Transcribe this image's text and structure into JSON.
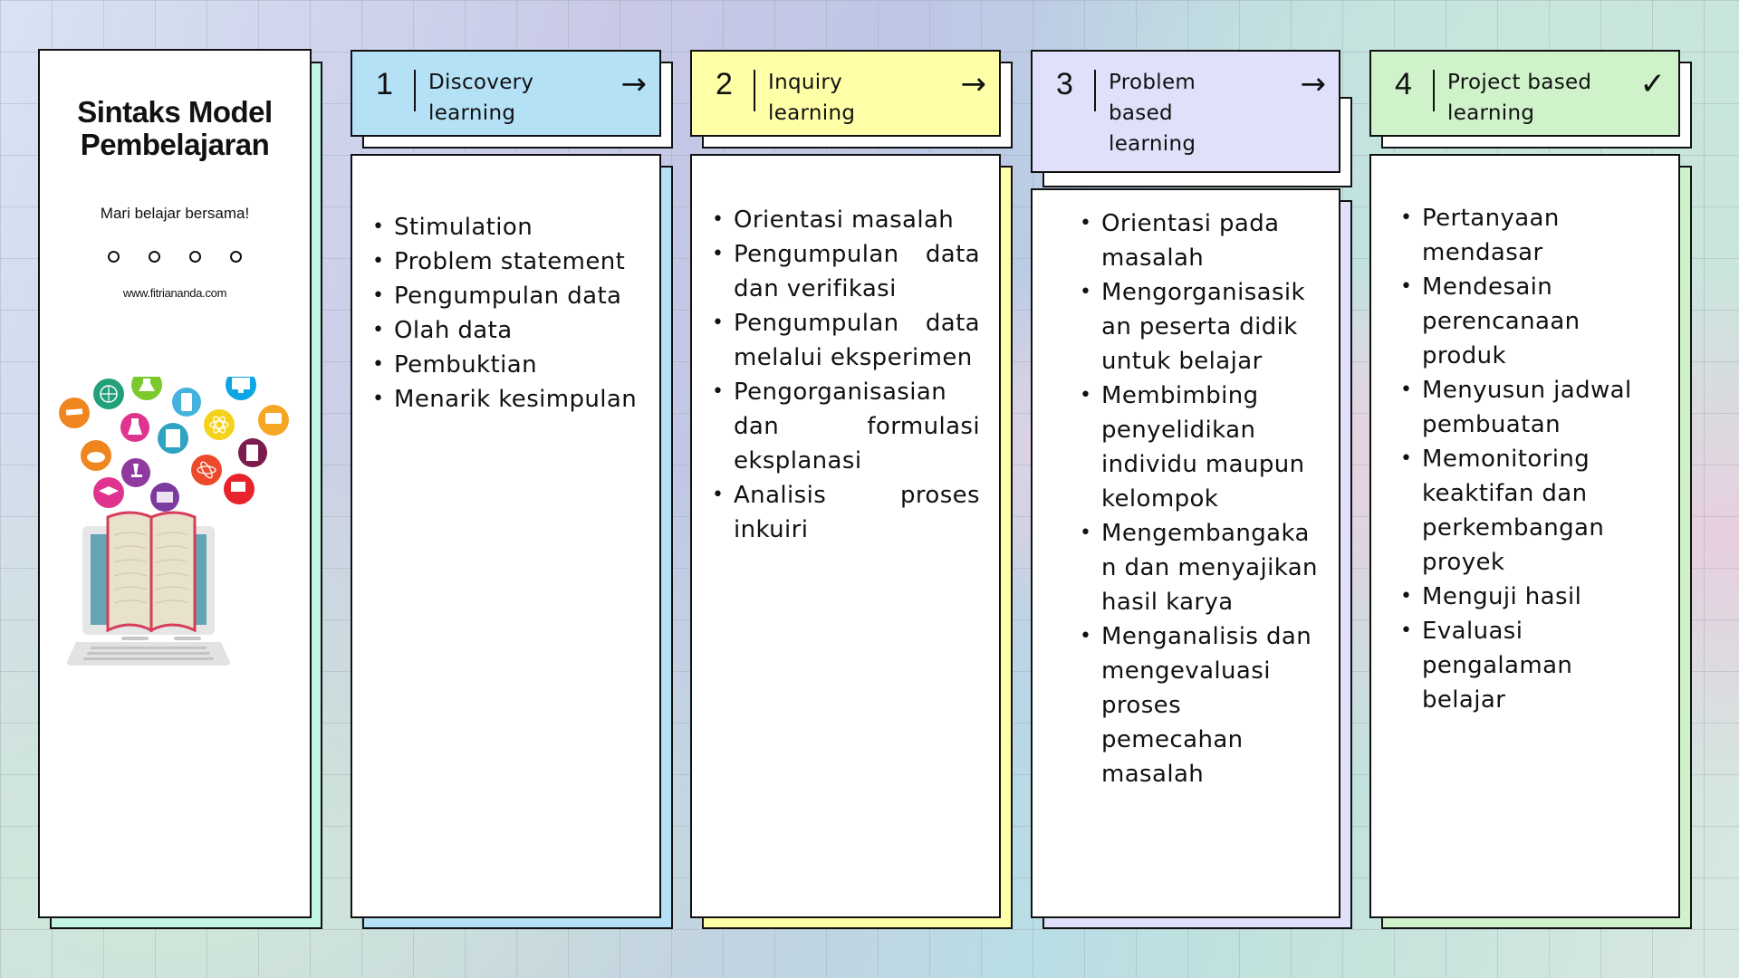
{
  "sidebar": {
    "title_line1": "Sintaks Model",
    "title_line2": "Pembelajaran",
    "subtitle": "Mari belajar bersama!",
    "website": "www.fitriananda.com",
    "dots_count": 4,
    "illustration": "laptop-with-open-book-and-education-icons"
  },
  "colors": {
    "card1": "#b5e1f7",
    "card2": "#ffffa8",
    "card3": "#e0e0fa",
    "card4": "#d0f2ca",
    "sidebar_accent": "#c3f5e3"
  },
  "cards": [
    {
      "number": "1",
      "title": "Discovery learning",
      "title_lines": [
        "Discovery",
        "learning"
      ],
      "icon": "arrow-right-icon",
      "icon_glyph": "→",
      "items": [
        {
          "lines": [
            "Stimulation"
          ]
        },
        {
          "lines": [
            "Problem statement"
          ]
        },
        {
          "lines": [
            "Pengumpulan data"
          ]
        },
        {
          "lines": [
            "Olah data"
          ]
        },
        {
          "lines": [
            "Pembuktian"
          ]
        },
        {
          "lines": [
            "Menarik kesimpulan"
          ]
        }
      ]
    },
    {
      "number": "2",
      "title": "Inquiry learning",
      "title_lines": [
        "Inquiry",
        "learning"
      ],
      "icon": "arrow-right-icon",
      "icon_glyph": "→",
      "items": [
        {
          "lines": [
            "Orientasi masalah"
          ]
        },
        {
          "lines": [
            "Pengumpulan data",
            "dan verifikasi"
          ]
        },
        {
          "lines": [
            "Pengumpulan data",
            "melalui eksperimen"
          ]
        },
        {
          "lines": [
            "Pengorganisasian",
            "dan formulasi",
            "eksplanasi"
          ]
        },
        {
          "lines": [
            "Analisis proses",
            "inkuiri"
          ]
        }
      ]
    },
    {
      "number": "3",
      "title": "Problem based learning",
      "title_lines": [
        "Problem",
        "based",
        "learning"
      ],
      "icon": "arrow-right-icon",
      "icon_glyph": "→",
      "items": [
        {
          "lines": [
            "Orientasi pada",
            "masalah"
          ]
        },
        {
          "lines": [
            "Mengorganisasik",
            "an peserta didik",
            "untuk belajar"
          ]
        },
        {
          "lines": [
            "Membimbing",
            "penyelidikan",
            "individu maupun",
            "kelompok"
          ]
        },
        {
          "lines": [
            "Mengembangaka",
            "n dan menyajikan",
            "hasil karya"
          ]
        },
        {
          "lines": [
            "Menganalisis dan",
            "mengevaluasi",
            "proses",
            "pemecahan",
            "masalah"
          ]
        }
      ]
    },
    {
      "number": "4",
      "title": "Project based learning",
      "title_lines": [
        "Project based",
        "learning"
      ],
      "icon": "checkmark-icon",
      "icon_glyph": "✓",
      "items": [
        {
          "lines": [
            "Pertanyaan",
            "mendasar"
          ]
        },
        {
          "lines": [
            "Mendesain",
            "perencanaan",
            "produk"
          ]
        },
        {
          "lines": [
            "Menyusun jadwal",
            "pembuatan"
          ]
        },
        {
          "lines": [
            "Memonitoring",
            "keaktifan dan",
            "perkembangan",
            "proyek"
          ]
        },
        {
          "lines": [
            "Menguji hasil"
          ]
        },
        {
          "lines": [
            "Evaluasi",
            "pengalaman",
            "belajar"
          ]
        }
      ]
    }
  ]
}
